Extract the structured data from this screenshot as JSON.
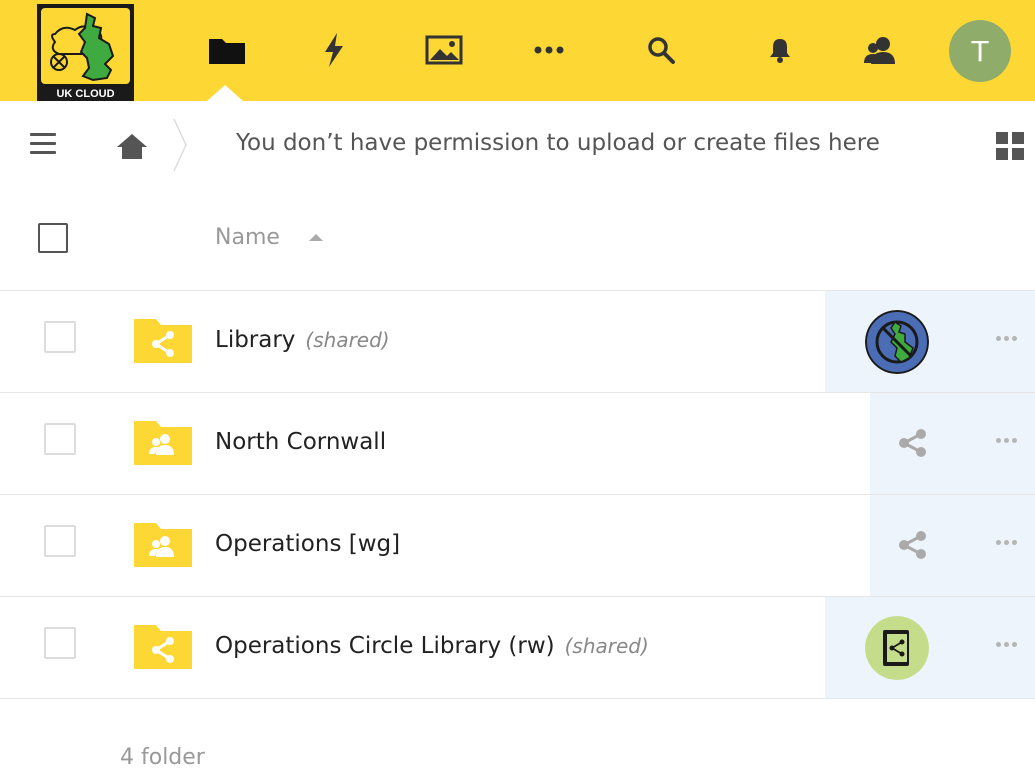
{
  "logo": {
    "text": "UK CLOUD"
  },
  "topnav": {
    "items": [
      {
        "name": "files",
        "icon": "folder-icon"
      },
      {
        "name": "activity",
        "icon": "lightning-icon"
      },
      {
        "name": "gallery",
        "icon": "image-icon"
      },
      {
        "name": "more-apps",
        "icon": "more-dots-icon"
      },
      {
        "name": "search",
        "icon": "search-icon"
      },
      {
        "name": "notifications",
        "icon": "bell-icon"
      },
      {
        "name": "contacts",
        "icon": "contacts-icon"
      }
    ],
    "avatar_letter": "T",
    "avatar_color": "#8fac6b",
    "bar_color": "#fdd835"
  },
  "subbar": {
    "permission_text": "You don’t have permission to upload or create files here"
  },
  "table": {
    "header": {
      "name_label": "Name",
      "sort": "ascending"
    },
    "rows": [
      {
        "name": "Library",
        "tag": "(shared)",
        "folder_type": "shared",
        "share_display": "avatar-uk",
        "highlight": true
      },
      {
        "name": "North Cornwall",
        "tag": "",
        "folder_type": "group",
        "share_display": "share-icon",
        "highlight": true
      },
      {
        "name": "Operations [wg]",
        "tag": "",
        "folder_type": "group",
        "share_display": "share-icon",
        "highlight": true
      },
      {
        "name": "Operations Circle Library (rw)",
        "tag": "(shared)",
        "folder_type": "shared",
        "share_display": "avatar-book",
        "highlight": true
      }
    ]
  },
  "footer": {
    "summary": "4 folder"
  }
}
